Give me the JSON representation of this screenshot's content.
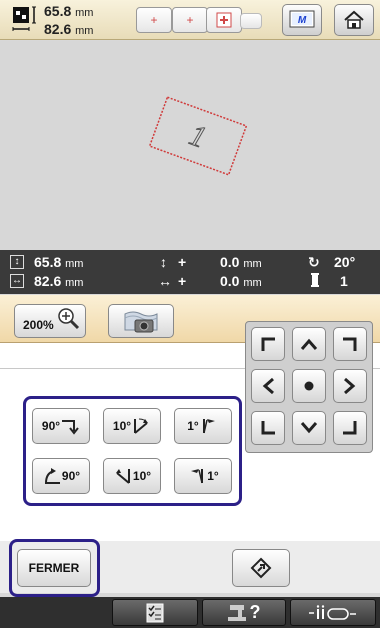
{
  "header": {
    "height_value": "65.8",
    "width_value": "82.6",
    "unit": "mm"
  },
  "pattern": {
    "glyph": "1"
  },
  "info": {
    "height_value": "65.8",
    "width_value": "82.6",
    "unit": "mm",
    "move_v_value": "0.0",
    "move_h_value": "0.0",
    "plus": "+",
    "rotation": "20°",
    "color_count": "1"
  },
  "toolbar": {
    "zoom_label": "200%"
  },
  "rotate": {
    "cw90": "90°",
    "cw10": "10°",
    "cw1": "1°",
    "ccw90": "90°",
    "ccw10": "10°",
    "ccw1": "1°"
  },
  "footer": {
    "close_label": "FERMER",
    "help_label": "?"
  },
  "colors": {
    "highlight": "#2c2088",
    "stitch": "#d03a3a"
  }
}
